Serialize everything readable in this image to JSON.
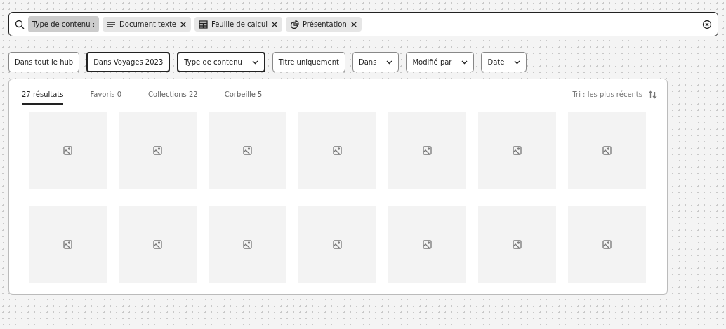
{
  "search": {
    "label": "Type de contenu :",
    "chips": [
      {
        "kind": "text",
        "label": "Document texte"
      },
      {
        "kind": "sheet",
        "label": "Feuille de calcul"
      },
      {
        "kind": "slides",
        "label": "Présentation"
      }
    ]
  },
  "filters": [
    {
      "label": "Dans tout le hub",
      "dropdown": false,
      "selected": false
    },
    {
      "label": "Dans Voyages 2023",
      "dropdown": false,
      "selected": true
    },
    {
      "label": "Type de contenu",
      "dropdown": true,
      "selected": true
    },
    {
      "label": "Titre uniquement",
      "dropdown": false,
      "selected": false
    },
    {
      "label": "Dans",
      "dropdown": true,
      "selected": false
    },
    {
      "label": "Modifié par",
      "dropdown": true,
      "selected": false
    },
    {
      "label": "Date",
      "dropdown": true,
      "selected": false
    }
  ],
  "tabs": [
    {
      "label": "27 résultats",
      "selected": true
    },
    {
      "label": "Favoris 0",
      "selected": false
    },
    {
      "label": "Collections 22",
      "selected": false
    },
    {
      "label": "Corbeille 5",
      "selected": false
    }
  ],
  "sort": "Tri : les plus récents"
}
